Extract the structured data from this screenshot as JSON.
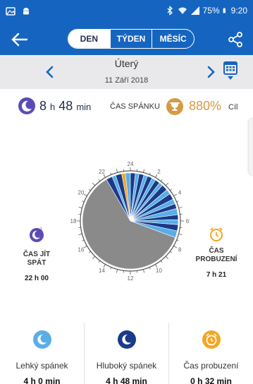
{
  "status_bar": {
    "battery": "75%",
    "time": "9:20",
    "icons": [
      "gallery-icon",
      "android-icon",
      "bluetooth-icon",
      "wifi-icon",
      "signal-icon",
      "battery-icon"
    ]
  },
  "toolbar": {
    "tabs": [
      {
        "label": "DEN",
        "active": true
      },
      {
        "label": "TÝDEN",
        "active": false
      },
      {
        "label": "MĚSÍC",
        "active": false
      }
    ]
  },
  "date_nav": {
    "day_name": "Úterý",
    "date": "11 Září 2018"
  },
  "summary": {
    "sleep_hours": "8",
    "sleep_h_unit": "h",
    "sleep_minutes": "48",
    "sleep_min_unit": "min",
    "label": "ČAS SPÁNKU",
    "percent": "880%",
    "goal_label": "Cíl"
  },
  "dial": {
    "hour_labels": [
      "24",
      "2",
      "4",
      "6",
      "8",
      "10",
      "12",
      "14",
      "16",
      "18",
      "20",
      "22"
    ]
  },
  "bedtime": {
    "label_line1": "ČAS JÍT",
    "label_line2": "SPÁT",
    "value": "22 h 00"
  },
  "wakeup": {
    "label_line1": "ČAS",
    "label_line2": "PROBUZENÍ",
    "value": "7 h 21"
  },
  "stats": [
    {
      "name": "Lehký spánek",
      "value": "4 h 0 min",
      "icon": "light-sleep-icon",
      "color": "#59aee6"
    },
    {
      "name": "Hluboký spánek",
      "value": "4 h 48 min",
      "icon": "deep-sleep-icon",
      "color": "#1a3a8a"
    },
    {
      "name": "Čas probuzení",
      "value": "0 h 32 min",
      "icon": "alarm-clock-icon",
      "color": "#f5a623"
    }
  ],
  "colors": {
    "primary": "#1565c0",
    "deep_sleep": "#1a3a8a",
    "light_sleep": "#59aee6",
    "awake": "#f5a623",
    "no_data": "#8a8a8a",
    "goal": "#d69a45"
  }
}
